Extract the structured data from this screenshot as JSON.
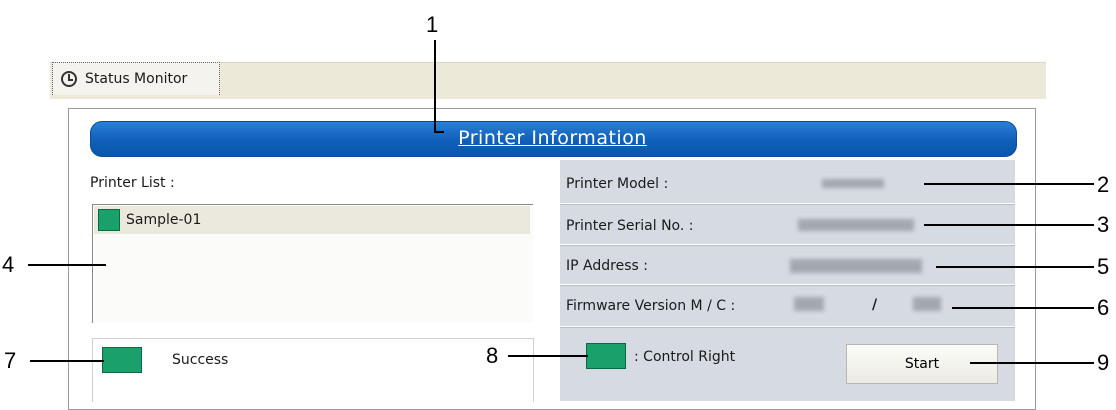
{
  "tab": {
    "label": "Status Monitor"
  },
  "header": {
    "title": "Printer Information"
  },
  "printer_list": {
    "label": "Printer List :",
    "items": [
      {
        "name": "Sample-01",
        "status_color": "#1aa06a"
      }
    ]
  },
  "status": {
    "text": "Success",
    "color": "#1aa06a"
  },
  "info": {
    "model_label": "Printer Model :",
    "serial_label": "Printer Serial No. :",
    "ip_label": "IP Address :",
    "firmware_label": "Firmware Version M / C :",
    "firmware_separator": "/"
  },
  "control": {
    "text": ": Control Right",
    "color": "#1aa06a"
  },
  "start_button": {
    "label": "Start"
  },
  "callouts": [
    "1",
    "2",
    "3",
    "4",
    "5",
    "6",
    "7",
    "8",
    "9"
  ]
}
